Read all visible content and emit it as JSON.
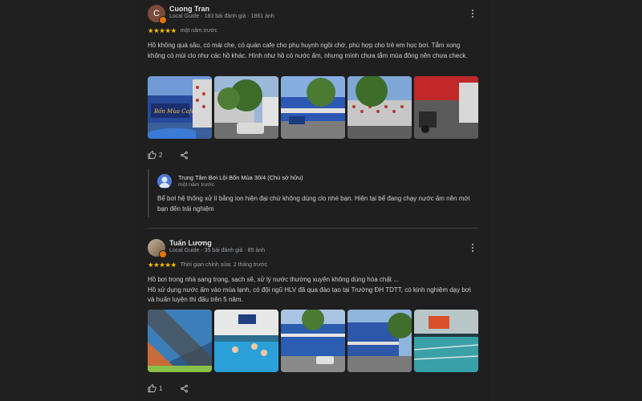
{
  "reviews": [
    {
      "avatar_letter": "C",
      "name": "Cuong Tran",
      "meta": "Local Guide · 183 bài đánh giá · 1861 ảnh",
      "stars": "★★★★★",
      "when": "một năm trước",
      "text": "Hồ không quá sâu, có mái che, có quán cafe cho phụ huynh ngồi chờ, phù hợp cho trẻ em học bơi. Tắm xong không có mùi clo như các hồ khác. Hình như hồ có nước ấm, nhưng mình chưa tắm mùa đông nên chưa check.",
      "likes": "2",
      "owner_reply": {
        "name": "Trung Tâm Bơi Lội Bốn Mùa 30/4 (Chủ sở hữu)",
        "when": "một năm trước",
        "text": "Bể bơi hệ thống xử lí bằng ion hiện đại chứ không dùng clo nhé bạn. Hiện tại bể đang chạy nước ấm nên mời bạn đến trải nghiệm"
      }
    },
    {
      "name": "Tuấn Lương",
      "meta": "Local Guide · 35 bài đánh giá · 85 ảnh",
      "stars": "★★★★★",
      "when": "Thời gian chỉnh sửa: 2 tháng trước",
      "text_line1": "Hồ bơi trong nhà sang trọng, sạch sẽ, xử lý nước thường xuyên không dùng hóa chất ...",
      "text_line2": "Hồ xử dụng nước ấm vào mùa lạnh, có đội ngũ HLV đã qua đào tạo tại Trường ĐH TDTT, có kinh nghiệm dạy bơi và huấn luyện thi đấu trên 5 năm.",
      "likes": "1"
    }
  ],
  "photo_sign_text": "Bốn Mùa Cafe",
  "icons": [
    "more-vert-icon",
    "thumb-up-icon",
    "share-icon"
  ],
  "colors": {
    "stars": "#fbbc04",
    "background": "#1f1f1f",
    "accent_badge": "#e37400"
  }
}
